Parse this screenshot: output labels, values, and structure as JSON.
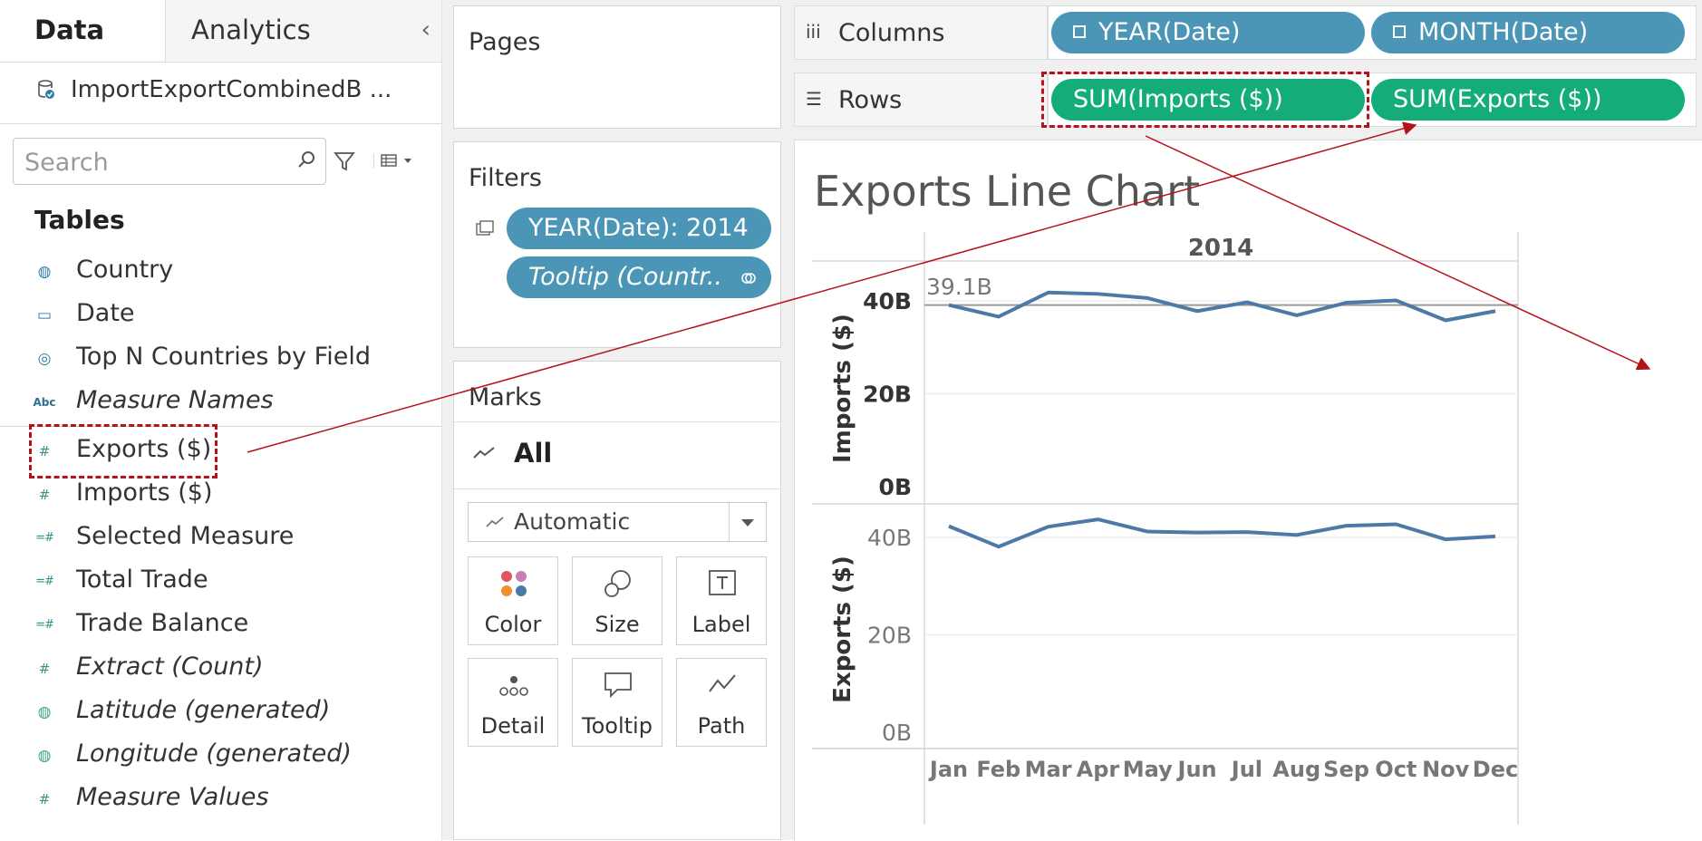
{
  "data_pane": {
    "tab_data": "Data",
    "tab_analytics": "Analytics",
    "collapse_glyph": "‹",
    "datasource_name": "ImportExportCombinedB ...",
    "search_placeholder": "Search",
    "tables_heading": "Tables",
    "fields": [
      {
        "label": "Country",
        "icon": "globe-icon",
        "italic": false
      },
      {
        "label": "Date",
        "icon": "calendar-icon",
        "italic": false
      },
      {
        "label": "Top N Countries by Field",
        "icon": "set-icon",
        "italic": false
      },
      {
        "label": "Measure Names",
        "icon": "abc-icon",
        "italic": true
      },
      {
        "label": "Exports ($)",
        "icon": "measure-icon",
        "italic": false
      },
      {
        "label": "Imports ($)",
        "icon": "measure-icon",
        "italic": false
      },
      {
        "label": "Selected Measure",
        "icon": "calc-measure-icon",
        "italic": false
      },
      {
        "label": "Total Trade",
        "icon": "calc-measure-icon",
        "italic": false
      },
      {
        "label": "Trade Balance",
        "icon": "calc-measure-icon",
        "italic": false
      },
      {
        "label": "Extract (Count)",
        "icon": "measure-icon",
        "italic": true
      },
      {
        "label": "Latitude (generated)",
        "icon": "globe-icon",
        "italic": true
      },
      {
        "label": "Longitude (generated)",
        "icon": "globe-icon",
        "italic": true
      },
      {
        "label": "Measure Values",
        "icon": "measure-icon",
        "italic": true
      }
    ],
    "abc_glyph": "Abc"
  },
  "pages": {
    "title": "Pages"
  },
  "filters": {
    "title": "Filters",
    "pills": [
      "YEAR(Date): 2014",
      "Tooltip (Countr.."
    ]
  },
  "marks": {
    "title": "Marks",
    "all_label": "All",
    "mark_type": "Automatic",
    "buttons": [
      "Color",
      "Size",
      "Label",
      "Detail",
      "Tooltip",
      "Path"
    ]
  },
  "shelves": {
    "columns_label": "Columns",
    "rows_label": "Rows",
    "columns_pills": [
      "YEAR(Date)",
      "MONTH(Date)"
    ],
    "rows_pills": [
      "SUM(Imports ($))",
      "SUM(Exports ($))"
    ]
  },
  "view": {
    "title": "Exports Line Chart",
    "callout": "39.1B"
  },
  "chart_data": {
    "type": "line",
    "title": "Exports Line Chart",
    "column_header": "2014",
    "categories": [
      "Jan",
      "Feb",
      "Mar",
      "Apr",
      "May",
      "Jun",
      "Jul",
      "Aug",
      "Sep",
      "Oct",
      "Nov",
      "Dec"
    ],
    "panes": [
      {
        "ylabel": "Imports ($)",
        "yticks": [
          "0B",
          "20B",
          "40B"
        ],
        "ylim": [
          0,
          45
        ],
        "reference_line": 39.1,
        "values": [
          39.1,
          36.6,
          41.8,
          41.5,
          40.6,
          37.8,
          39.7,
          36.9,
          39.6,
          40.1,
          35.8,
          37.8
        ]
      },
      {
        "ylabel": "Exports ($)",
        "yticks": [
          "0B",
          "20B",
          "40B"
        ],
        "ylim": [
          0,
          45
        ],
        "values": [
          42.3,
          38.1,
          42.2,
          43.7,
          41.2,
          41.0,
          41.1,
          40.5,
          42.4,
          42.7,
          39.6,
          40.2
        ]
      }
    ],
    "line_color": "#4e79a7",
    "grid": true,
    "legend": "none"
  }
}
